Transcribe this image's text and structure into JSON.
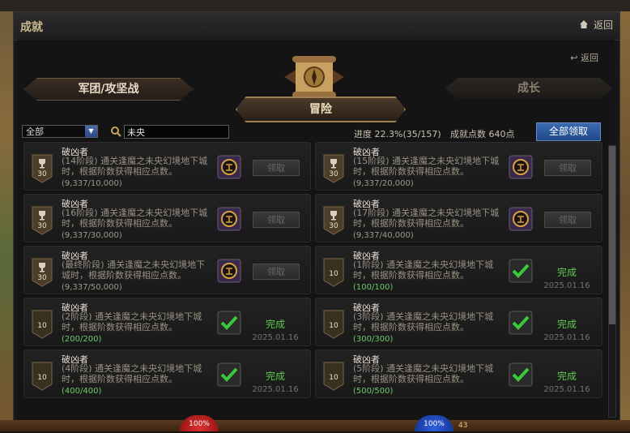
{
  "window": {
    "title": "成就",
    "back": "返回"
  },
  "inner": {
    "back": "返回"
  },
  "tabs": {
    "left": "军团/攻坚战",
    "center": "冒险",
    "right": "成长"
  },
  "filter": {
    "selected": "全部",
    "search_value": "未央"
  },
  "summary": {
    "progress": "进度  22.3%(35/157)",
    "points": "成就点数 640点",
    "claim_all": "全部领取"
  },
  "achievements": [
    {
      "name": "破凶者",
      "desc": "(14阶段) 通关逢魔之未央幻境地下城时，根据阶数获得相应点数。",
      "progress": "(9,337/10,000)",
      "badge": "30",
      "state": "claim",
      "action": "领取",
      "date": ""
    },
    {
      "name": "破凶者",
      "desc": "(15阶段) 通关逢魔之未央幻境地下城时，根据阶数获得相应点数。",
      "progress": "(9,337/20,000)",
      "badge": "30",
      "state": "claim",
      "action": "领取",
      "date": ""
    },
    {
      "name": "破凶者",
      "desc": "(16阶段) 通关逢魔之未央幻境地下城时，根据阶数获得相应点数。",
      "progress": "(9,337/30,000)",
      "badge": "30",
      "state": "claim",
      "action": "领取",
      "date": ""
    },
    {
      "name": "破凶者",
      "desc": "(17阶段) 通关逢魔之未央幻境地下城时，根据阶数获得相应点数。",
      "progress": "(9,337/40,000)",
      "badge": "30",
      "state": "claim",
      "action": "领取",
      "date": ""
    },
    {
      "name": "破凶者",
      "desc": "(最终阶段) 通关逢魔之未央幻境地下城时，根据阶数获得相应点数。",
      "progress": "(9,337/50,000)",
      "badge": "30",
      "state": "claim",
      "action": "领取",
      "date": ""
    },
    {
      "name": "破凶者",
      "desc": "(1阶段) 通关逢魔之未央幻境地下城时，根据阶数获得相应点数。",
      "progress": "(100/100)",
      "badge": "10",
      "state": "done",
      "action": "完成",
      "date": "2025.01.16"
    },
    {
      "name": "破凶者",
      "desc": "(2阶段) 通关逢魔之未央幻境地下城时，根据阶数获得相应点数。",
      "progress": "(200/200)",
      "badge": "10",
      "state": "done",
      "action": "完成",
      "date": "2025.01.16"
    },
    {
      "name": "破凶者",
      "desc": "(3阶段) 通关逢魔之未央幻境地下城时，根据阶数获得相应点数。",
      "progress": "(300/300)",
      "badge": "10",
      "state": "done",
      "action": "完成",
      "date": "2025.01.16"
    },
    {
      "name": "破凶者",
      "desc": "(4阶段) 通关逢魔之未央幻境地下城时，根据阶数获得相应点数。",
      "progress": "(400/400)",
      "badge": "10",
      "state": "done",
      "action": "完成",
      "date": "2025.01.16"
    },
    {
      "name": "破凶者",
      "desc": "(5阶段) 通关逢魔之未央幻境地下城时，根据阶数获得相应点数。",
      "progress": "(500/500)",
      "badge": "10",
      "state": "done",
      "action": "完成",
      "date": "2025.01.16"
    }
  ],
  "hud": {
    "hp": "100%",
    "mp": "100%",
    "level": "43"
  }
}
